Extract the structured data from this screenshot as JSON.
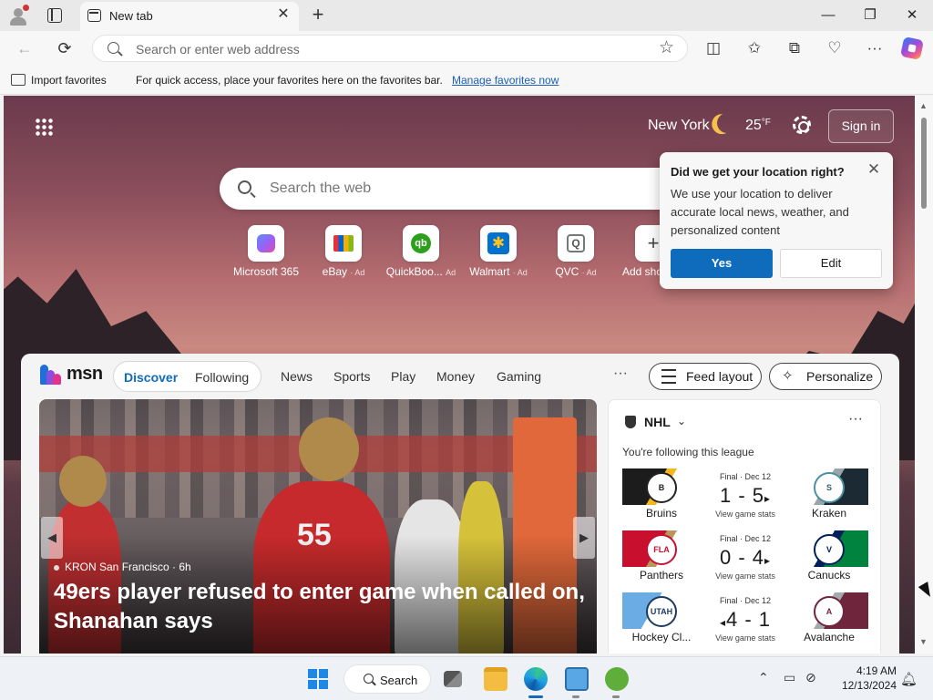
{
  "browser": {
    "tab_title": "New tab",
    "address_placeholder": "Search or enter web address",
    "window_controls": {
      "minimize": "—",
      "restore": "❐",
      "close": "✕"
    }
  },
  "favbar": {
    "import_label": "Import favorites",
    "message": "For quick access, place your favorites here on the favorites bar.",
    "manage_link": "Manage favorites now"
  },
  "newtab": {
    "weather": {
      "city": "New York",
      "temp": "25",
      "unit": "°F"
    },
    "sign_in": "Sign in",
    "search_placeholder": "Search the web",
    "quick_links": [
      {
        "label": "Microsoft 365",
        "ad": "",
        "icon": "microsoft-365-icon"
      },
      {
        "label": "eBay",
        "ad": "· Ad",
        "icon": "ebay-icon"
      },
      {
        "label": "QuickBoo...",
        "ad": "Ad",
        "icon": "quickbooks-icon"
      },
      {
        "label": "Walmart",
        "ad": "· Ad",
        "icon": "walmart-icon"
      },
      {
        "label": "QVC",
        "ad": "· Ad",
        "icon": "qvc-icon"
      },
      {
        "label": "Add sho",
        "ad": "",
        "icon": "plus-icon"
      }
    ],
    "location_popup": {
      "title": "Did we get your location right?",
      "body": "We use your location to deliver accurate local news, weather, and personalized content",
      "yes": "Yes",
      "edit": "Edit"
    }
  },
  "feed": {
    "brand": "msn",
    "tabs": {
      "discover": "Discover",
      "following": "Following"
    },
    "nav": [
      "News",
      "Sports",
      "Play",
      "Money",
      "Gaming"
    ],
    "more": "···",
    "feed_layout": "Feed layout",
    "personalize": "Personalize",
    "hero": {
      "source": "KRON San Francisco · 6h",
      "headline": "49ers player refused to enter game when called on, Shanahan says",
      "jersey": "55"
    },
    "sports": {
      "league": "NHL",
      "subtitle": "You're following this league",
      "more": "···",
      "games": [
        {
          "status": "Final · Dec 12",
          "score": "1 - 5",
          "arrow": "▸",
          "home": "Bruins",
          "away": "Kraken",
          "stats": "View game stats",
          "home_color": "#f5b81c",
          "away_color": "#1c2a33"
        },
        {
          "status": "Final · Dec 12",
          "score": "0 - 4",
          "arrow": "▸",
          "home": "Panthers",
          "away": "Canucks",
          "stats": "View game stats",
          "home_color": "#c8102e",
          "away_color": "#00843d"
        },
        {
          "status": "Final · Dec 12",
          "score": "4 - 1",
          "arrow": "◂",
          "home": "Hockey Cl...",
          "away": "Avalanche",
          "stats": "View game stats",
          "home_color": "#6cace4",
          "away_color": "#6f263d"
        }
      ]
    }
  },
  "taskbar": {
    "search_label": "Search",
    "time": "4:19 AM",
    "date": "12/13/2024"
  }
}
